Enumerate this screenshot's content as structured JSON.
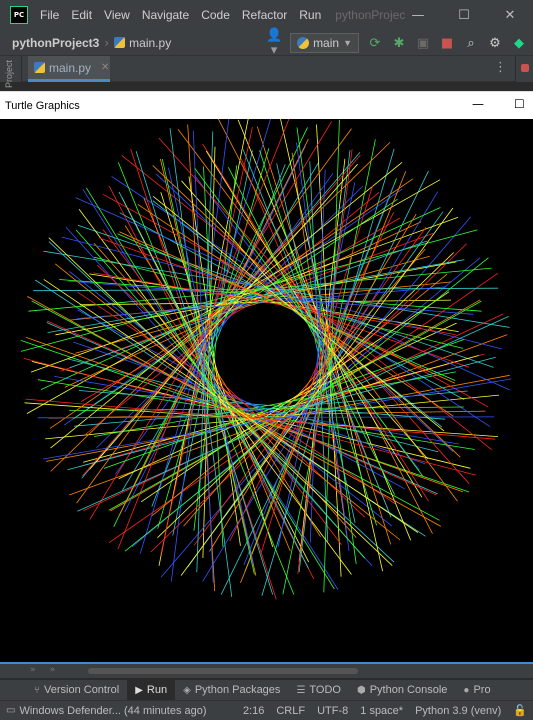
{
  "app": {
    "logo_text": "PC",
    "menu": [
      "File",
      "Edit",
      "View",
      "Navigate",
      "Code",
      "Refactor",
      "Run"
    ],
    "project_faded": "pythonProjec",
    "window_controls": [
      "—",
      "☐",
      "✕"
    ]
  },
  "nav": {
    "project": "pythonProject3",
    "file": "main.py",
    "run_config": "main"
  },
  "editor": {
    "side_label": "Project",
    "tab_label": "main.py"
  },
  "turtle": {
    "title": "Turtle Graphics",
    "controls": [
      "—",
      "☐"
    ],
    "colors": [
      "#ff2222",
      "#ff8800",
      "#ffff33",
      "#33ff33",
      "#33cccc",
      "#3355ff"
    ]
  },
  "toolwindows": [
    {
      "label": "Version Control",
      "icon": "version-control-icon"
    },
    {
      "label": "Run",
      "icon": "run-icon"
    },
    {
      "label": "Python Packages",
      "icon": "layers-icon"
    },
    {
      "label": "TODO",
      "icon": "list-icon"
    },
    {
      "label": "Python Console",
      "icon": "python-icon"
    },
    {
      "label": "Pro",
      "icon": "problems-icon"
    }
  ],
  "status": {
    "message": "Windows Defender... (44 minutes ago)",
    "position": "2:16",
    "line_sep": "CRLF",
    "encoding": "UTF-8",
    "indent": "1 space*",
    "interpreter": "Python 3.9 (venv)"
  }
}
